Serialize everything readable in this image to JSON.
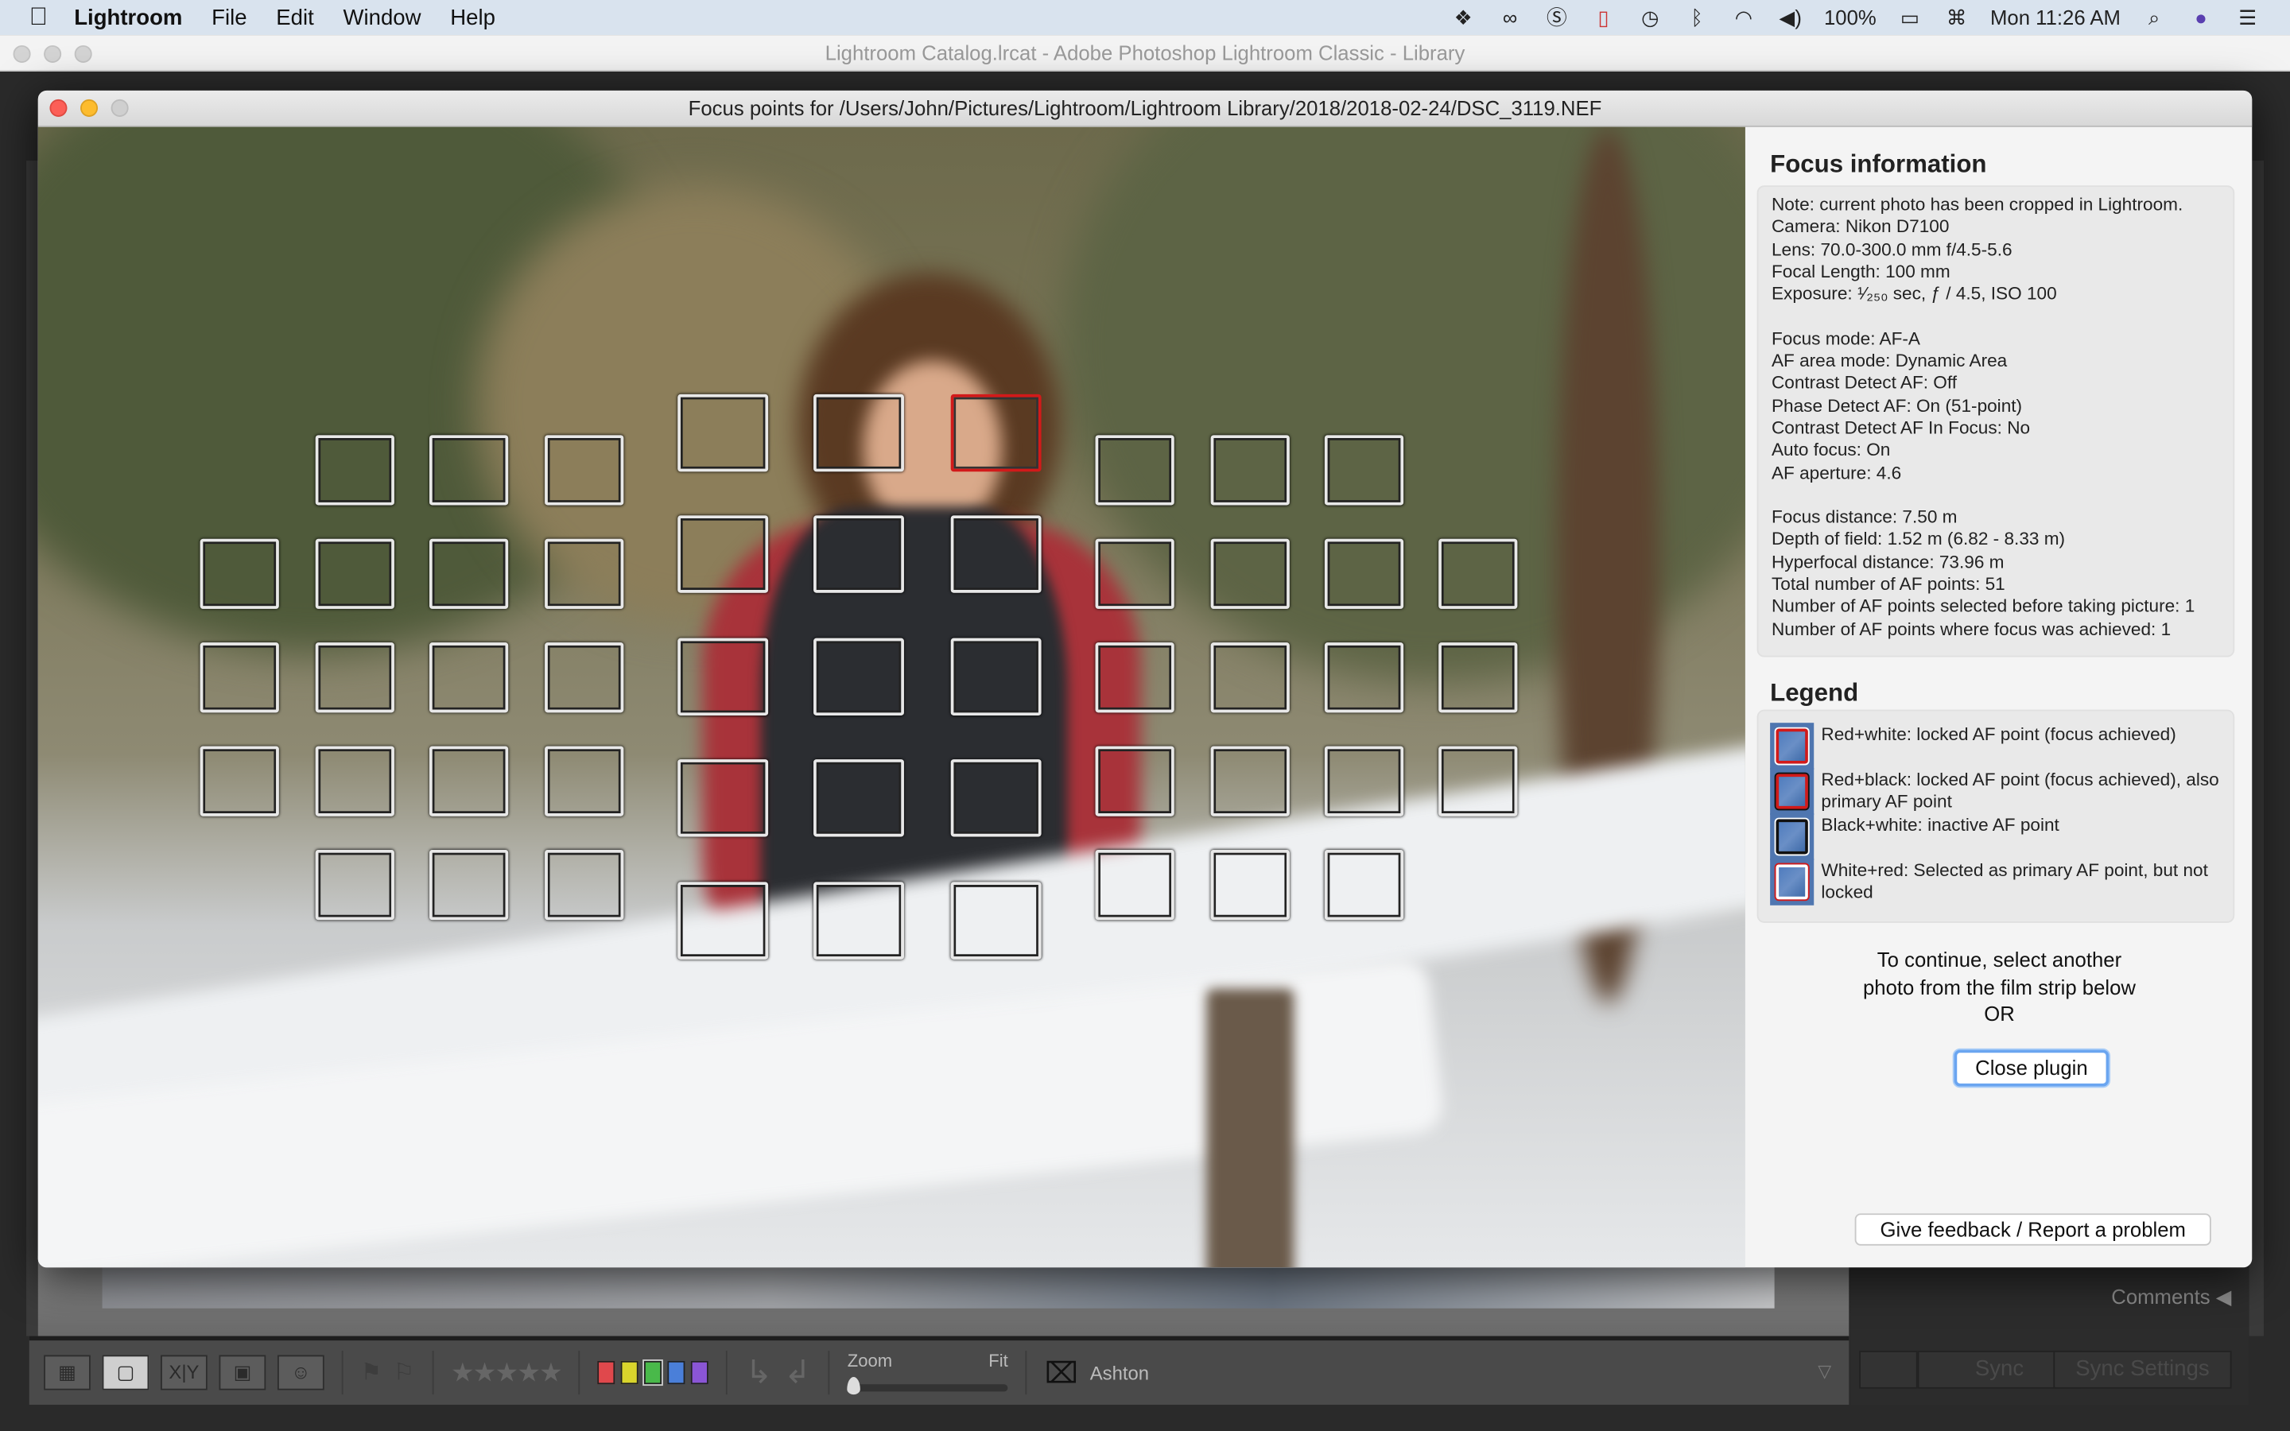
{
  "menubar": {
    "apple_icon": "apple-logo",
    "app_name": "Lightroom",
    "menus": [
      "File",
      "Edit",
      "Window",
      "Help"
    ],
    "status_icons": [
      "dropbox-icon",
      "creative-cloud-icon",
      "s-shield-icon",
      "phone-alert-icon",
      "time-machine-icon",
      "bluetooth-icon",
      "wifi-icon",
      "volume-icon"
    ],
    "battery": "100%",
    "clock": "Mon 11:26 AM"
  },
  "lightroom": {
    "window_title": "Lightroom Catalog.lrcat - Adobe Photoshop Lightroom Classic - Library",
    "toolbar": {
      "zoom_label": "Zoom",
      "fit_label": "Fit",
      "people_name": "Ashton",
      "color_labels": [
        "#e0484c",
        "#d9d52c",
        "#49b94a",
        "#4a7fd9",
        "#8a55d6"
      ],
      "selected_color_label": "#49b94a"
    },
    "right_panel": {
      "comments": "Comments",
      "sync": "Sync",
      "sync_settings": "Sync Settings"
    }
  },
  "dialog": {
    "title": "Focus points for /Users/John/Pictures/Lightroom/Lightroom Library/2018/2018-02-24/DSC_3119.NEF",
    "af_points": {
      "total": 51,
      "locked_point": {
        "group": "center",
        "row": 1,
        "col": 3
      },
      "locked_color": "#d21a1a",
      "inactive_color": "#e8e8e8"
    },
    "focus_info": {
      "heading": "Focus information",
      "block1": [
        "Note: current photo has been cropped in Lightroom.",
        "Camera: Nikon D7100",
        "Lens: 70.0-300.0 mm f/4.5-5.6",
        "Focal Length: 100 mm",
        "Exposure: ¹⁄₂₅₀ sec, ƒ / 4.5, ISO 100"
      ],
      "block2": [
        "Focus mode: AF-A",
        "AF area mode: Dynamic Area",
        "Contrast Detect AF: Off",
        "Phase Detect AF: On (51-point)",
        "Contrast Detect AF In Focus: No",
        "Auto focus: On",
        "AF aperture: 4.6"
      ],
      "block3": [
        "Focus distance: 7.50 m",
        "Depth of field: 1.52 m (6.82 - 8.33 m)",
        "Hyperfocal distance: 73.96 m",
        "Total number of AF points: 51",
        "Number of AF points selected before taking picture: 1",
        "Number of AF points where focus was achieved: 1"
      ]
    },
    "legend": {
      "heading": "Legend",
      "items": [
        {
          "text": "Red+white: locked AF point (focus achieved)",
          "outer": "#ffffff",
          "inner": "#d21a1a"
        },
        {
          "text": "Red+black: locked AF point (focus achieved), also primary AF point",
          "outer": "#111111",
          "inner": "#d21a1a"
        },
        {
          "text": "Black+white: inactive AF point",
          "outer": "#ffffff",
          "inner": "#111111"
        },
        {
          "text": "White+red: Selected as primary AF point, but not locked",
          "outer": "#d21a1a",
          "inner": "#ffffff"
        }
      ]
    },
    "continue_text": [
      "To continue, select another",
      "photo from the film strip below",
      "OR"
    ],
    "close_button": "Close plugin",
    "feedback_button": "Give feedback / Report a problem"
  }
}
